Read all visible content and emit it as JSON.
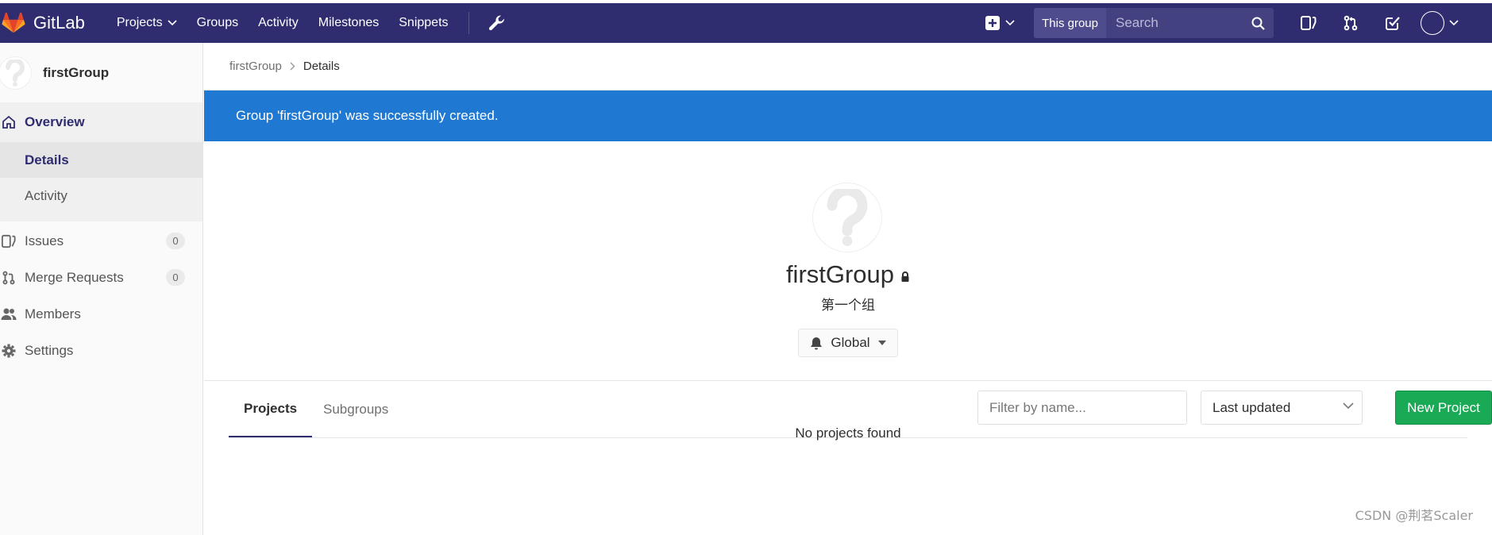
{
  "topbar": {
    "brand": "GitLab",
    "nav": [
      "Projects",
      "Groups",
      "Activity",
      "Milestones",
      "Snippets"
    ],
    "search_scope": "This group",
    "search_placeholder": "Search",
    "bg_color": "#2f2d70"
  },
  "sidebar": {
    "context_name": "firstGroup",
    "overview_label": "Overview",
    "sub_items": [
      "Details",
      "Activity"
    ],
    "issues_label": "Issues",
    "issues_count": "0",
    "merge_requests_label": "Merge Requests",
    "merge_requests_count": "0",
    "members_label": "Members",
    "settings_label": "Settings"
  },
  "breadcrumb": {
    "parent": "firstGroup",
    "current": "Details"
  },
  "flash": {
    "message": "Group 'firstGroup' was successfully created.",
    "color": "#1f78d1"
  },
  "group": {
    "name": "firstGroup",
    "description": "第一个组",
    "notification_level": "Global"
  },
  "projects_section": {
    "tabs": [
      "Projects",
      "Subgroups"
    ],
    "filter_placeholder": "Filter by name...",
    "sort_value": "Last updated",
    "new_project_label": "New Project",
    "new_project_color": "#1aaa55",
    "empty_message": "No projects found"
  },
  "watermark": "CSDN @荆茗Scaler"
}
